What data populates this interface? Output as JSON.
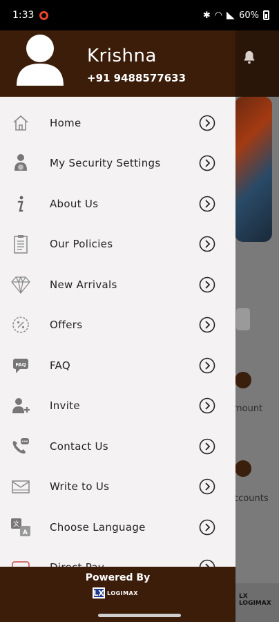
{
  "status_bar": {
    "time": "1:33",
    "battery": "60%"
  },
  "drawer": {
    "user_name": "Krishna",
    "phone": "+91 9488577633",
    "menu_items": [
      {
        "label": "Home",
        "icon": "home-icon"
      },
      {
        "label": "My Security Settings",
        "icon": "security-person-icon"
      },
      {
        "label": "About Us",
        "icon": "info-icon"
      },
      {
        "label": "Our Policies",
        "icon": "clipboard-icon"
      },
      {
        "label": "New Arrivals",
        "icon": "diamond-icon"
      },
      {
        "label": "Offers",
        "icon": "discount-badge-icon"
      },
      {
        "label": "FAQ",
        "icon": "faq-chat-icon"
      },
      {
        "label": "Invite",
        "icon": "add-user-icon"
      },
      {
        "label": "Contact Us",
        "icon": "phone-chat-icon"
      },
      {
        "label": "Write to Us",
        "icon": "mail-icon"
      },
      {
        "label": "Choose Language",
        "icon": "translate-icon"
      },
      {
        "label": "Direct Pay",
        "icon": "card-icon"
      }
    ],
    "footer": {
      "powered_by": "Powered By",
      "logo_mark": "LX",
      "logo_text": "LOGIMAX"
    }
  },
  "background": {
    "text_amount": "mount",
    "text_accounts": "ccounts",
    "logo_text": "LOGIMAX"
  },
  "colors": {
    "brand_brown": "#3b1d0a",
    "drawer_bg": "#f4f2f3"
  }
}
